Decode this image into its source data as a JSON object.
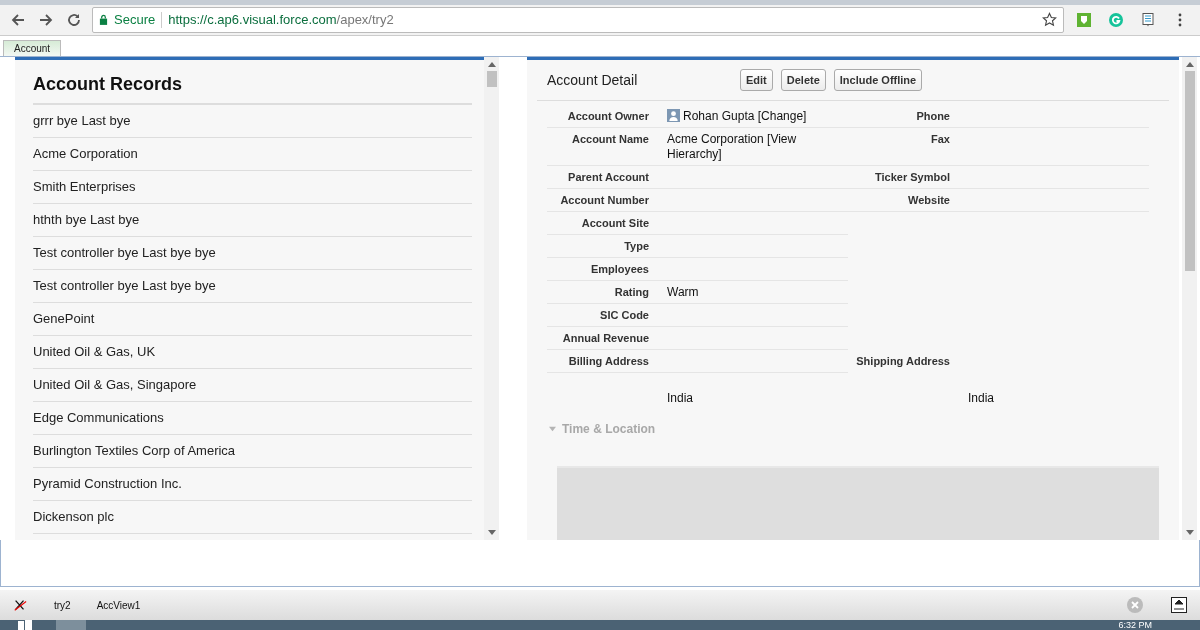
{
  "browser": {
    "secure_label": "Secure",
    "url_host": "https://c.ap6.visual.force.com",
    "url_path": "/apex/try2"
  },
  "page_tabs": [
    {
      "label": "Account",
      "selected": true
    }
  ],
  "records": {
    "title": "Account Records",
    "items": [
      {
        "name": "grrr bye Last bye"
      },
      {
        "name": "Acme Corporation"
      },
      {
        "name": "Smith Enterprises"
      },
      {
        "name": "hthth bye Last bye"
      },
      {
        "name": "Test controller bye Last bye bye"
      },
      {
        "name": "Test controller bye Last bye bye"
      },
      {
        "name": "GenePoint"
      },
      {
        "name": "United Oil & Gas, UK"
      },
      {
        "name": "United Oil & Gas, Singapore"
      },
      {
        "name": "Edge Communications"
      },
      {
        "name": "Burlington Textiles Corp of America"
      },
      {
        "name": "Pyramid Construction Inc."
      },
      {
        "name": "Dickenson plc"
      }
    ]
  },
  "detail": {
    "title": "Account Detail",
    "buttons": [
      "Edit",
      "Delete",
      "Include Offline"
    ],
    "rows": [
      {
        "left": {
          "label": "Account Owner",
          "value": "Rohan Gupta [Change]",
          "kind": "user"
        },
        "right": {
          "label": "Phone"
        }
      },
      {
        "left": {
          "label": "Account Name",
          "value": "Acme Corporation [View Hierarchy]",
          "kind": "text"
        },
        "right": {
          "label": "Fax"
        }
      },
      {
        "left": {
          "label": "Parent Account",
          "kind": "text"
        },
        "right": {
          "label": "Ticker Symbol"
        }
      },
      {
        "left": {
          "label": "Account Number",
          "kind": "text"
        },
        "right": {
          "label": "Website"
        }
      },
      {
        "left": {
          "label": "Account Site",
          "kind": "text"
        }
      },
      {
        "left": {
          "label": "Type",
          "kind": "text"
        }
      },
      {
        "left": {
          "label": "Employees",
          "kind": "text"
        }
      },
      {
        "left": {
          "label": "Rating",
          "value": "Warm",
          "kind": "text"
        }
      },
      {
        "left": {
          "label": "SIC Code",
          "kind": "text"
        }
      },
      {
        "left": {
          "label": "Annual Revenue",
          "kind": "text"
        }
      },
      {
        "left": {
          "label": "Billing Address",
          "kind": "text"
        },
        "right": {
          "label": "Shipping Address"
        }
      }
    ],
    "billing_address": "India",
    "shipping_address": "India",
    "section": {
      "title": "Time & Location",
      "expanded": true
    }
  },
  "dev_bar": {
    "items": [
      "try2",
      "AccView1"
    ]
  },
  "taskbar": {
    "clock": "6:32 PM"
  }
}
